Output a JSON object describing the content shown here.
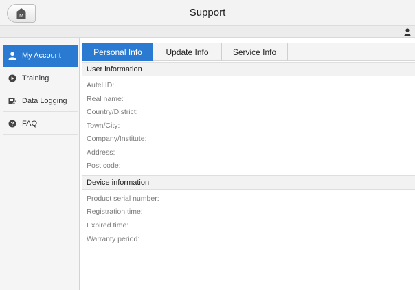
{
  "header": {
    "title": "Support",
    "home_icon_letter": "M"
  },
  "sidebar": {
    "items": [
      {
        "label": "My Account",
        "icon": "person-icon",
        "active": true
      },
      {
        "label": "Training",
        "icon": "play-circle-icon",
        "active": false
      },
      {
        "label": "Data Logging",
        "icon": "edit-note-icon",
        "active": false
      },
      {
        "label": "FAQ",
        "icon": "help-circle-icon",
        "active": false
      }
    ]
  },
  "tabs": [
    {
      "label": "Personal Info",
      "active": true
    },
    {
      "label": "Update Info",
      "active": false
    },
    {
      "label": "Service Info",
      "active": false
    }
  ],
  "user_info": {
    "header": "User information",
    "fields": [
      "Autel ID:",
      "Real name:",
      "Country/District:",
      "Town/City:",
      "Company/Institute:",
      "Address:",
      "Post code:"
    ]
  },
  "device_info": {
    "header": "Device information",
    "fields": [
      "Product serial number:",
      "Registration time:",
      "Expired time:",
      "Warranty period:"
    ]
  },
  "colors": {
    "accent": "#2a7ad2",
    "sidebar_bg": "#f5f5f5",
    "header_bg": "#f3f3f3",
    "field_text": "#7b7b7b"
  }
}
